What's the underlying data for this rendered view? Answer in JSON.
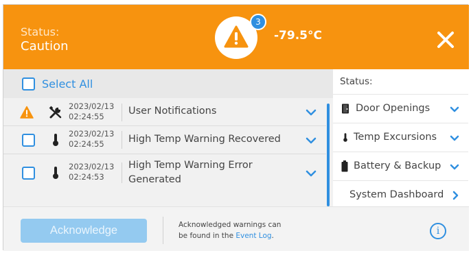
{
  "header": {
    "status_label": "Status:",
    "status_value": "Caution",
    "alert_count": "3",
    "temperature": "-79.5°C",
    "colors": {
      "bar": "#f7930f",
      "badge": "#2f8fe0"
    }
  },
  "list": {
    "select_all_label": "Select All",
    "items": [
      {
        "icon": "warning-icon",
        "date": "2023/02/13",
        "time": "02:24:55",
        "message": "User Notifications",
        "type_icon": "tools-icon"
      },
      {
        "icon": "checkbox",
        "date": "2023/02/13",
        "time": "02:24:55",
        "message": "High Temp Warning Recovered",
        "type_icon": "thermometer-icon"
      },
      {
        "icon": "checkbox",
        "date": "2023/02/13",
        "time": "02:24:53",
        "message_line1": "High Temp Warning Error",
        "message_line2": "Generated",
        "type_icon": "thermometer-icon"
      }
    ]
  },
  "side": {
    "status_label": "Status:",
    "items": [
      {
        "label": "Door Openings",
        "icon": "door-icon"
      },
      {
        "label": "Temp Excursions",
        "icon": "thermometer-icon"
      },
      {
        "label": "Battery & Backup",
        "icon": "battery-icon"
      },
      {
        "label": "System Dashboard",
        "icon": ""
      }
    ]
  },
  "footer": {
    "acknowledge_label": "Acknowledge",
    "note_line1": "Acknowledged warnings can",
    "note_line2_prefix": "be found in the ",
    "note_link": "Event Log",
    "note_suffix": ".",
    "info_glyph": "i"
  }
}
